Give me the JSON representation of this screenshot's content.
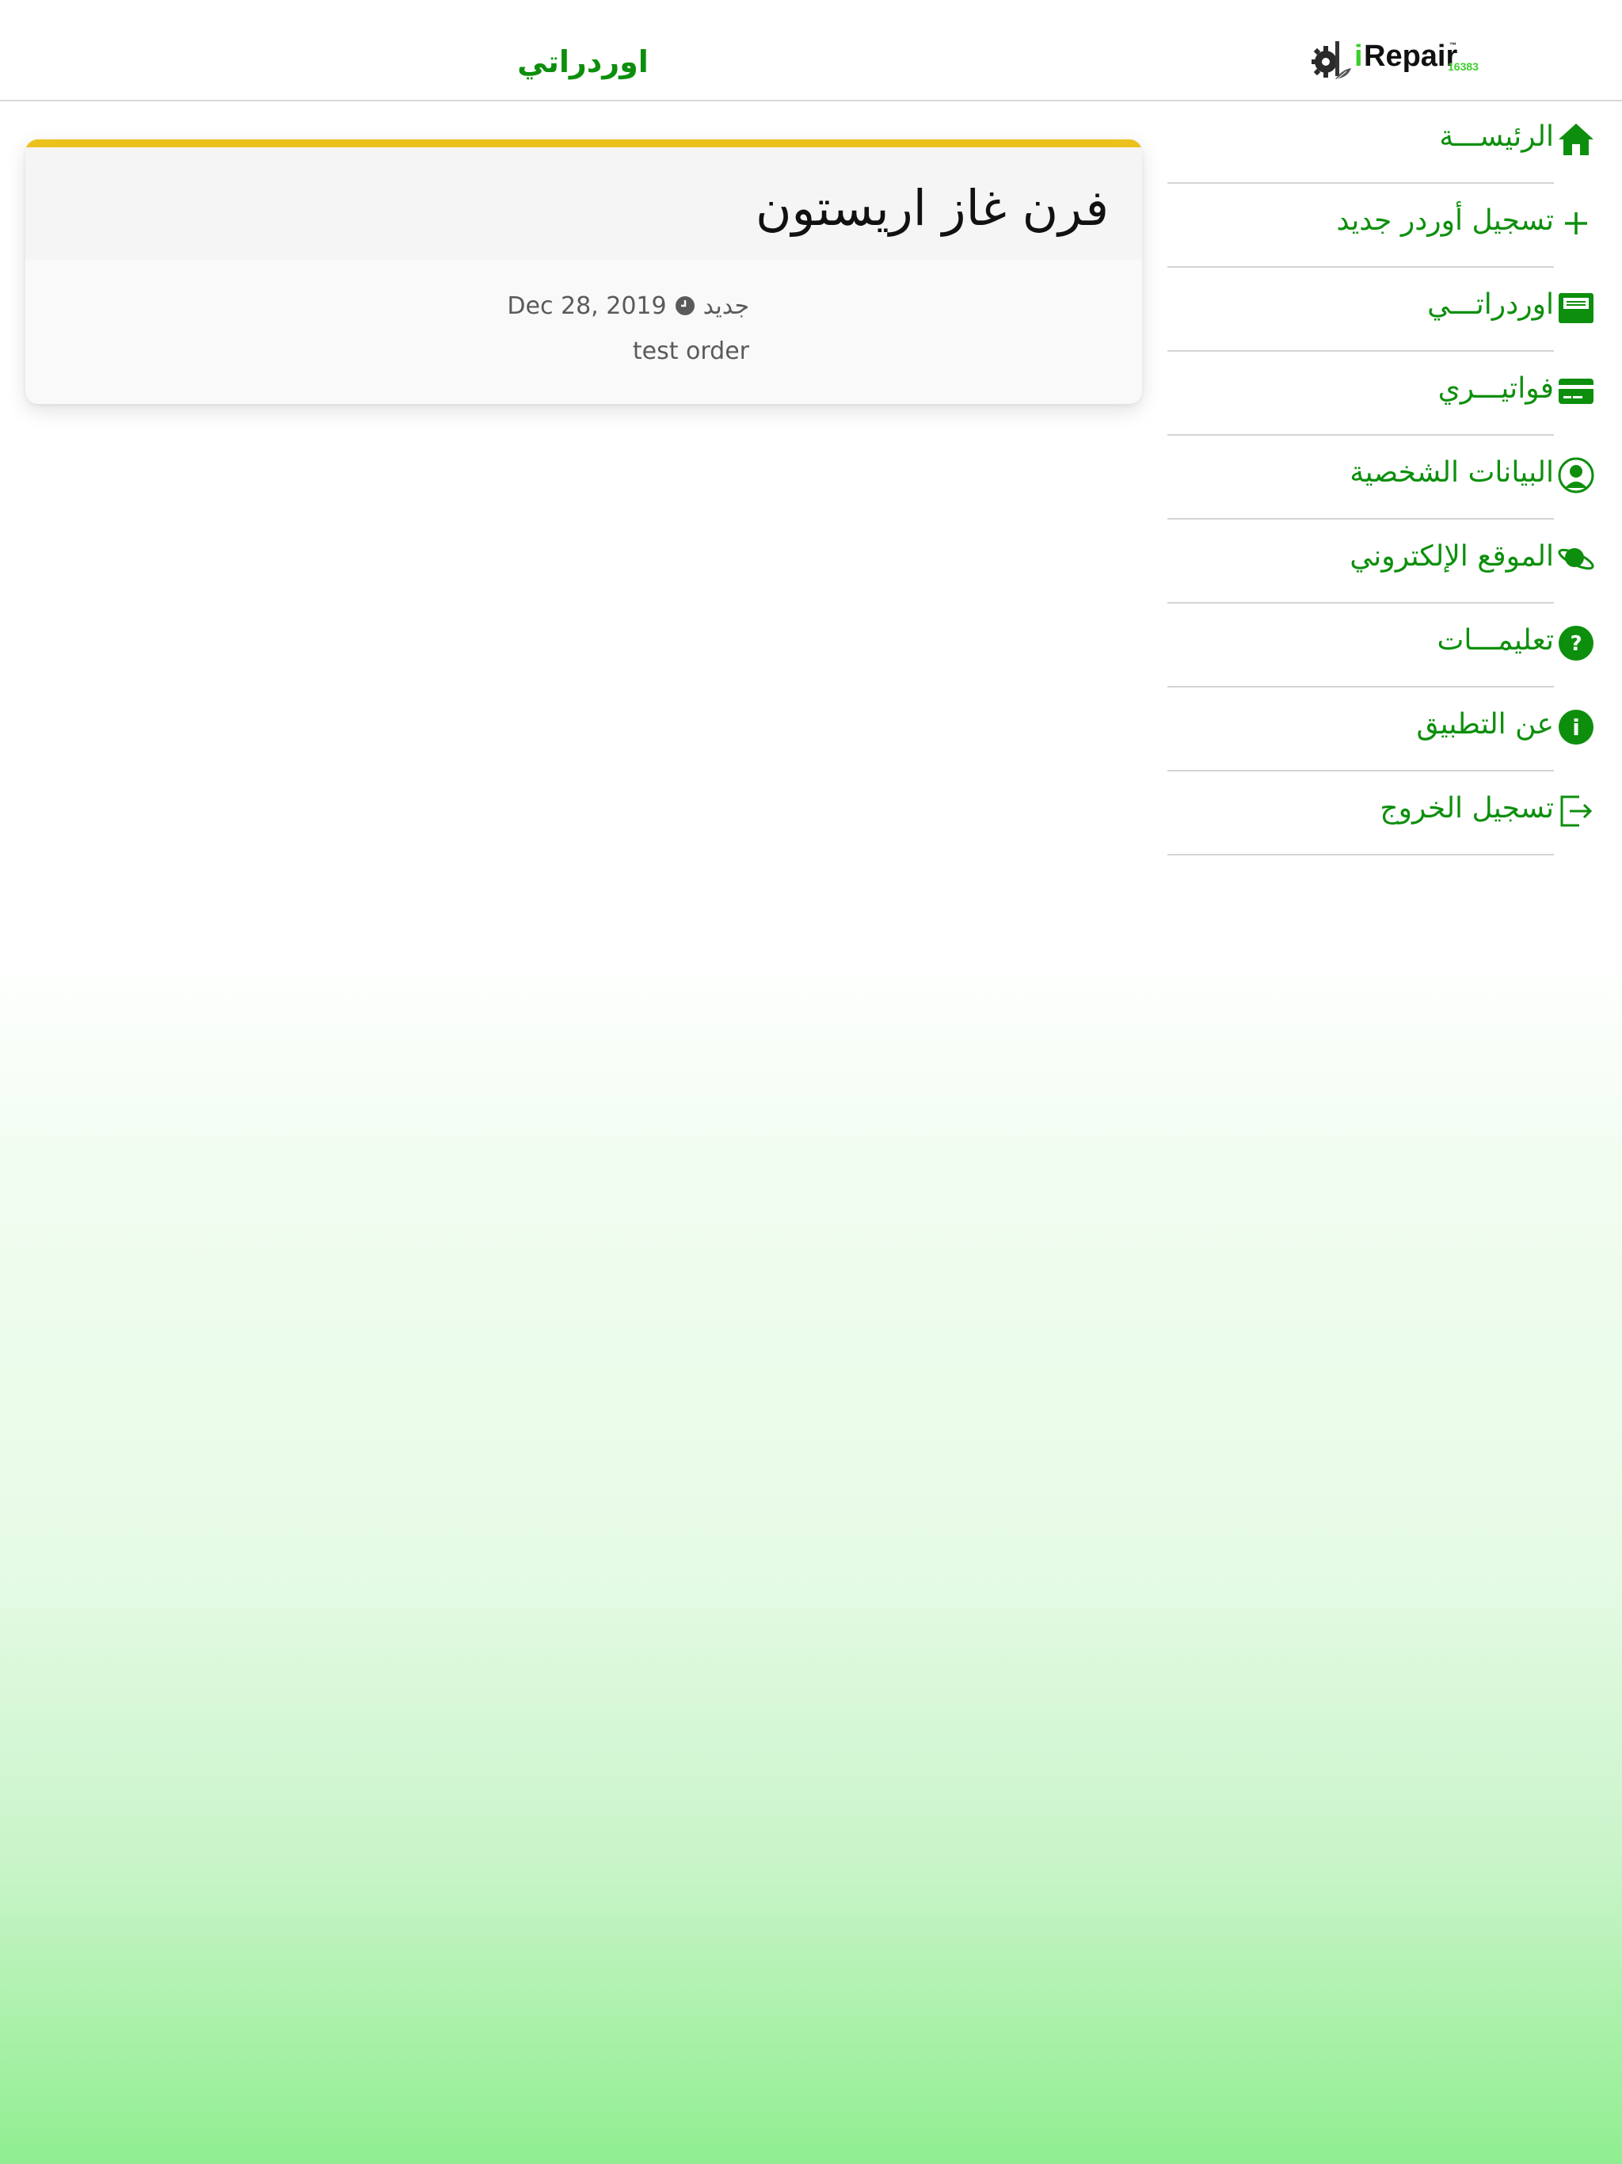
{
  "header": {
    "title": "اوردراتي",
    "logo": {
      "brand_prefix": "i",
      "brand_name": "Repair",
      "trademark": "™",
      "number": "16383"
    }
  },
  "order_card": {
    "title": "فرن غاز اريستون",
    "status": "جديد",
    "date": "Dec 28, 2019",
    "description": "test order",
    "accent_color": "#ecc11c"
  },
  "menu": {
    "items": [
      {
        "label": "الرئيســـة",
        "icon": "home-icon"
      },
      {
        "label": "تسجيل أوردر جديد",
        "icon": "plus-icon"
      },
      {
        "label": "اوردراتـــي",
        "icon": "inbox-icon"
      },
      {
        "label": "فواتيـــري",
        "icon": "credit-card-icon"
      },
      {
        "label": "البيانات الشخصية",
        "icon": "user-icon"
      },
      {
        "label": "الموقع الإلكتروني",
        "icon": "planet-icon"
      },
      {
        "label": "تعليمـــات",
        "icon": "question-icon"
      },
      {
        "label": "عن التطبيق",
        "icon": "info-icon"
      },
      {
        "label": "تسجيل الخروج",
        "icon": "logout-icon"
      }
    ]
  },
  "colors": {
    "primary_green": "#0d8f0d",
    "card_accent": "#ecc11c",
    "gradient_bottom": "#90ee90"
  }
}
